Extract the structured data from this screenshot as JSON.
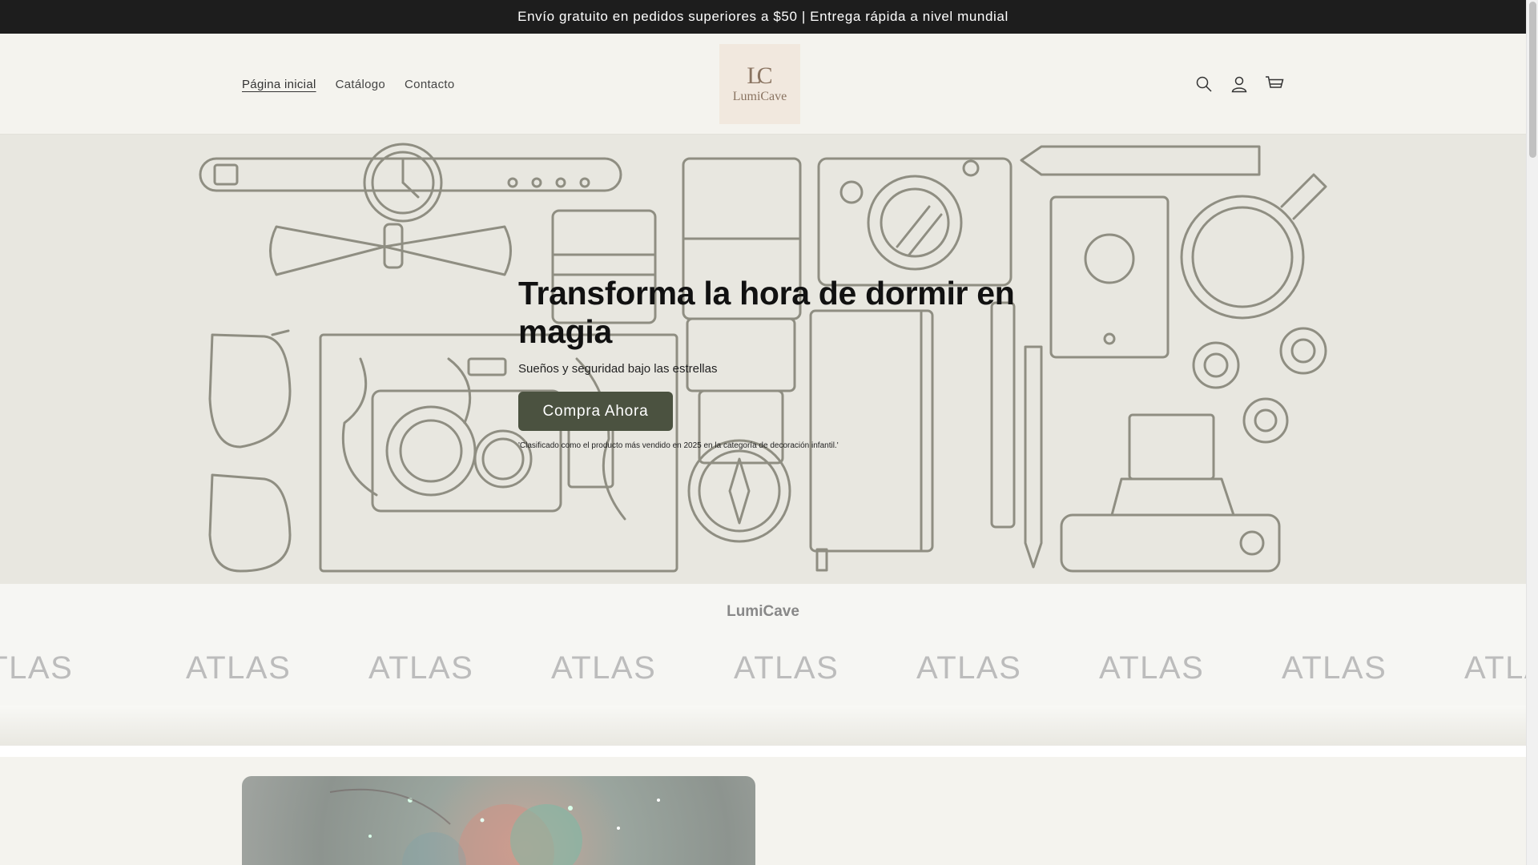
{
  "announcement": {
    "text": "Envío gratuito en pedidos superiores a $50 | Entrega rápida a nivel mundial"
  },
  "header": {
    "nav": [
      {
        "label": "Página inicial",
        "active": true
      },
      {
        "label": "Catálogo",
        "active": false
      },
      {
        "label": "Contacto",
        "active": false
      }
    ],
    "logo": {
      "monogram": "LC",
      "wordmark": "LumiCave"
    },
    "icons": [
      "search-icon",
      "account-icon",
      "cart-icon"
    ]
  },
  "hero": {
    "title": "Transforma la hora de dormir en magia",
    "subtitle": "Sueños y seguridad bajo las estrellas",
    "button_label": "Compra Ahora",
    "note": "'Clasificado como el producto más vendido en 2025 en la categoría de decoración infantil.'"
  },
  "brand_strip": {
    "name": "LumiCave",
    "marquee_word": "ATLAS"
  },
  "colors": {
    "announcement_bg": "#1d1d1d",
    "page_bg": "#f4f3ee",
    "hero_bg": "#e8e7e0",
    "illustration_stroke": "#8f8e82",
    "button_bg": "#4b5240",
    "logo_bg": "#f1e8de"
  }
}
